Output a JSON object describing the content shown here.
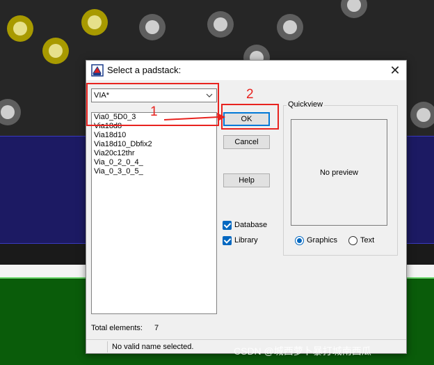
{
  "dialog": {
    "title": "Select a padstack:",
    "close_glyph": "✕",
    "filter_value": "VIA*",
    "padstacks": [
      "Via0_5D0_3",
      "Via18d8",
      "Via18d10",
      "Via18d10_Dbfix2",
      "Via20c12thr",
      "Via_0_2_0_4_",
      "Via_0_3_0_5_"
    ],
    "buttons": {
      "ok": "OK",
      "cancel": "Cancel",
      "help": "Help"
    },
    "sources": {
      "database": "Database",
      "library": "Library",
      "database_checked": true,
      "library_checked": true
    },
    "quickview": {
      "label": "Quickview",
      "preview_text": "No preview"
    },
    "view_mode": {
      "graphics": "Graphics",
      "text": "Text",
      "selected": "Graphics"
    },
    "total_label": "Total elements:",
    "total_value": "7",
    "status": "No valid name selected."
  },
  "annotations": {
    "step1": "1",
    "step2": "2",
    "color": "#e8231f"
  },
  "watermark": "CSDN @城西萝卜暴打城南西瓜",
  "colors": {
    "accent": "#0067c0",
    "default_button_border": "#0078d7",
    "pcb_blue": "#1c1a63",
    "pcb_green": "#0a5c0a",
    "pad_yellow": "#e6e08a"
  },
  "icons": {
    "app": "padstack-app-icon",
    "combo_arrow": "chevron-down-icon",
    "close": "close-icon"
  }
}
